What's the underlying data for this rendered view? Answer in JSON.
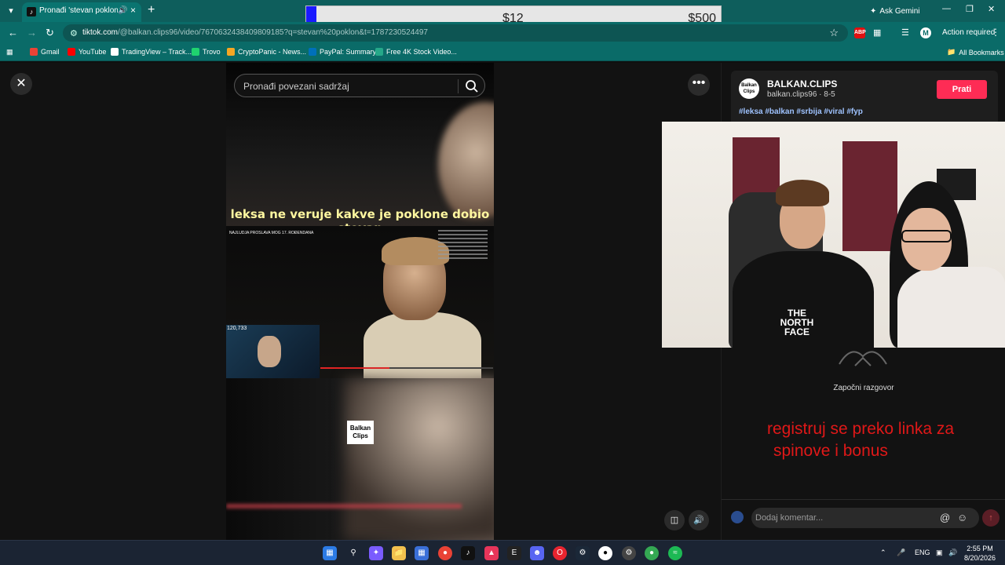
{
  "browser": {
    "tab": {
      "title": "Pronađi 'stevan poklon' na",
      "favicon": "tiktok-icon"
    },
    "ask_gemini": "Ask Gemini",
    "url_host": "tiktok.com",
    "url_path": "/@balkan.clips96/video/7670632438409809185?q=stevan%20poklon&t=1787230524497",
    "action_required": "Action required",
    "profile_initial": "M",
    "bookmarks": [
      {
        "label": "Gmail",
        "color": "#ea4335"
      },
      {
        "label": "YouTube",
        "color": "#ff0000"
      },
      {
        "label": "TradingView – Track...",
        "color": "#ffffff"
      },
      {
        "label": "Trovo",
        "color": "#1fd36f"
      },
      {
        "label": "CryptoPanic - News...",
        "color": "#f5a623"
      },
      {
        "label": "PayPal: Summary",
        "color": "#0070ba"
      },
      {
        "label": "Free 4K Stock Video...",
        "color": "#25a889"
      }
    ],
    "all_bookmarks": "All Bookmarks"
  },
  "donation": {
    "current": "$12",
    "goal": "$500",
    "progress": 0.024
  },
  "page": {
    "search_placeholder": "Pronađi povezani sadržaj",
    "video_caption": "leksa ne veruje kakve je poklone dobio stevan",
    "video_overlay_title": "NAJLUDJA PROSLAVA MOG 17. ROĐENDANA",
    "inset_viewers": "120,733",
    "logo_text": "Balkan Clips",
    "account_name": "BALKAN.CLIPS",
    "account_sub": "balkan.clips96 · 8-5",
    "follow_label": "Prati",
    "hashtags": "#leksa #balkan #srbija #viral #fyp",
    "empty_comments": "Započni razgovor",
    "comment_placeholder": "Dodaj komentar...",
    "promo_line1": "registruj se preko linka za",
    "promo_line2": "spinove i bonus",
    "webcam_shirt": "THE NORTH FACE"
  },
  "taskbar": {
    "lang": "ENG",
    "time": "2:55 PM",
    "date": "8/20/2026"
  }
}
